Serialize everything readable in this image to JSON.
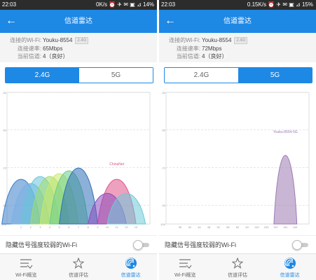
{
  "colors": {
    "accent": "#1e88e5",
    "statusbar": "#2c2c2c"
  },
  "panels": [
    {
      "status": {
        "time": "22:03",
        "stats": "0K/s ⏰ ✈ ✉ ▣ ⊿ 14%"
      },
      "appbar": {
        "title": "信道雷达",
        "back_icon": "back-arrow-icon"
      },
      "info": {
        "ssid_label": "连接的Wi-Fi:",
        "ssid": "Youku-8554",
        "band_badge": "2.4G",
        "speed_label": "连接速率:",
        "speed": "65Mbps",
        "channel_label": "当前信道:",
        "channel": "4（良好）"
      },
      "segment": {
        "options": [
          "2.4G",
          "5G"
        ],
        "selected": 0
      },
      "hidden_wifi_label": "隐藏信号强度较弱的Wi-Fi",
      "tabs": [
        {
          "label": "Wi-Fi概览",
          "icon": "wifi-list-icon"
        },
        {
          "label": "信道评估",
          "icon": "star-icon"
        },
        {
          "label": "信道雷达",
          "icon": "radar-icon"
        }
      ],
      "active_tab": 2,
      "chart_data": {
        "type": "area",
        "y_ticks": [
          "-30",
          "-50",
          "-70",
          "-90",
          "-100"
        ],
        "ylim": [
          -100,
          -30
        ],
        "x_ticks": [
          "1",
          "2",
          "3",
          "4",
          "5",
          "6",
          "7",
          "8",
          "9",
          "10",
          "11",
          "12",
          "13"
        ],
        "grid": true,
        "series": [
          {
            "name": "",
            "channel": 1,
            "peak": -72,
            "color": "#3a7ec9"
          },
          {
            "name": "",
            "channel": 2,
            "peak": -75,
            "color": "#7ab0e6"
          },
          {
            "name": "",
            "channel": 3,
            "peak": -70,
            "color": "#68c4d8"
          },
          {
            "name": "",
            "channel": 4,
            "peak": -70,
            "color": "#9fdc68"
          },
          {
            "name": "",
            "channel": 5,
            "peak": -68,
            "color": "#c9e76a"
          },
          {
            "name": "",
            "channel": 6,
            "peak": -66,
            "color": "#6acd8b"
          },
          {
            "name": "",
            "channel": 7,
            "peak": -64,
            "color": "#2d6fb6"
          },
          {
            "name": "ChinaNet",
            "channel": 11,
            "peak": -72,
            "color": "#e0528b"
          },
          {
            "name": "",
            "channel": 10,
            "peak": -82,
            "color": "#8a4cbe"
          },
          {
            "name": "",
            "channel": 12,
            "peak": -82,
            "color": "#6ecad8"
          }
        ]
      }
    },
    {
      "status": {
        "time": "22:03",
        "stats": "0.15K/s ⏰ ✈ ✉ ▣ ⊿ 15%"
      },
      "appbar": {
        "title": "信道雷达",
        "back_icon": "back-arrow-icon"
      },
      "info": {
        "ssid_label": "连接的Wi-Fi:",
        "ssid": "Youku-8554",
        "band_badge": "2.4G",
        "speed_label": "连接速率:",
        "speed": "72Mbps",
        "channel_label": "当前信道:",
        "channel": "4（良好）"
      },
      "segment": {
        "options": [
          "2.4G",
          "5G"
        ],
        "selected": 1
      },
      "hidden_wifi_label": "隐藏信号强度较弱的Wi-Fi",
      "tabs": [
        {
          "label": "Wi-Fi概览",
          "icon": "wifi-list-icon"
        },
        {
          "label": "信道评估",
          "icon": "star-icon"
        },
        {
          "label": "信道雷达",
          "icon": "radar-icon"
        }
      ],
      "active_tab": 2,
      "chart_data": {
        "type": "area",
        "y_ticks": [
          "-30",
          "-50",
          "-70",
          "-90",
          "-100"
        ],
        "ylim": [
          -100,
          -30
        ],
        "x_ticks": [
          "36",
          "40",
          "44",
          "48",
          "52",
          "56",
          "60",
          "64",
          "149",
          "153",
          "157",
          "161",
          "165"
        ],
        "grid": true,
        "series": [
          {
            "name": "Youku-8554-5G",
            "channel": 161,
            "peak": -55,
            "color": "#9c7ab3"
          }
        ]
      }
    }
  ]
}
